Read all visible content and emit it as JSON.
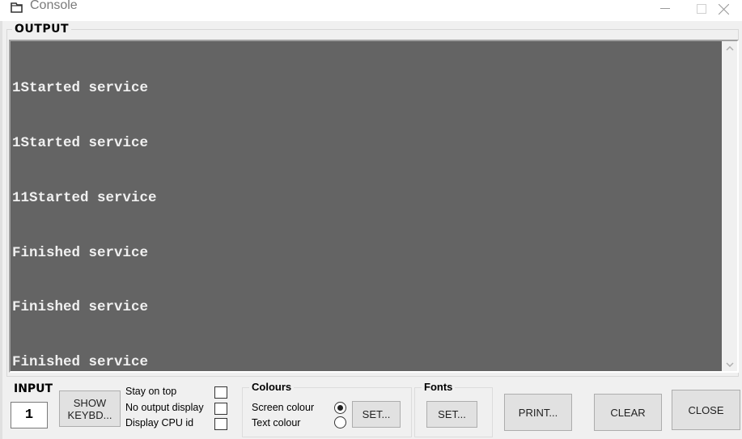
{
  "window": {
    "title": "Console",
    "icon": "console-window-icon",
    "controls": {
      "minimize": "—",
      "maximize": "☐",
      "close": "✕"
    }
  },
  "output": {
    "label": "OUTPUT",
    "lines": [
      "1Started service",
      "1Started service",
      "11Started service",
      "Finished service",
      "Finished service",
      "Finished service"
    ],
    "background_color": "#646464",
    "text_color": "#f0f0f0",
    "scroll_up": "︿",
    "scroll_down": "﹀"
  },
  "input": {
    "label": "INPUT",
    "value": "1"
  },
  "show_keyboard_button": {
    "line1": "SHOW",
    "line2": "KEYBD..."
  },
  "options": [
    {
      "label": "Stay on top",
      "checked": false
    },
    {
      "label": "No output display",
      "checked": false
    },
    {
      "label": "Display CPU id",
      "checked": false
    }
  ],
  "colours": {
    "label": "Colours",
    "options": [
      {
        "label": "Screen colour",
        "selected": true
      },
      {
        "label": "Text colour",
        "selected": false
      }
    ],
    "set_button": "SET..."
  },
  "fonts": {
    "label": "Fonts",
    "set_button": "SET..."
  },
  "buttons": {
    "print": "PRINT...",
    "clear": "CLEAR",
    "close": "CLOSE"
  }
}
